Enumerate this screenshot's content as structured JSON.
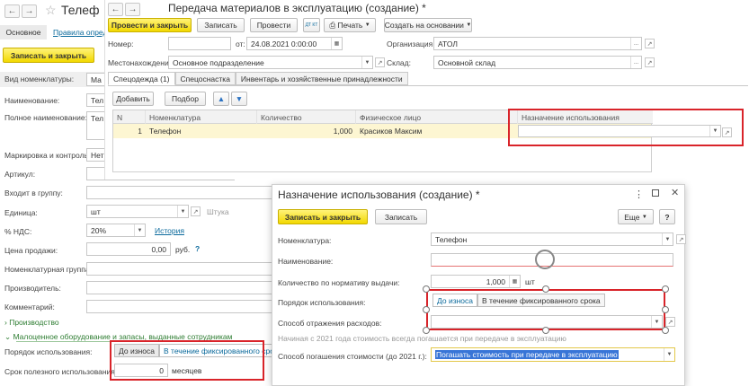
{
  "bg_window": {
    "title": "Телеф",
    "tabs": [
      "Основное",
      "Правила опред"
    ],
    "save_close": "Записать и закрыть",
    "fields": {
      "kind_label": "Вид номенклатуры:",
      "kind_value": "Ма",
      "name_label": "Наименование:",
      "name_value": "Тел",
      "fullname_label": "Полное наименование:",
      "fullname_value": "Тел",
      "marking_label": "Маркировка и контроль:",
      "marking_value": "Нет",
      "article_label": "Артикул:",
      "group_label": "Входит в группу:",
      "unit_label": "Единица:",
      "unit_value": "шт",
      "unit_hint": "Штука",
      "vat_label": "% НДС:",
      "vat_value": "20%",
      "vat_link": "История",
      "price_label": "Цена продажи:",
      "price_value": "0,00",
      "price_unit": "руб.",
      "price_help": "?",
      "nomgroup_label": "Номенклатурная группа:",
      "producer_label": "Производитель:",
      "comment_label": "Комментарий:"
    },
    "section_production": "Производство",
    "section_low": "Малоценное оборудование и запасы, выданные сотрудникам",
    "usage_order_label": "Порядок использования:",
    "usage_options": [
      "До износа",
      "В течение фиксированного срока"
    ],
    "life_label": "Срок полезного использования:",
    "life_value": "0",
    "life_unit": "месяцев"
  },
  "doc_window": {
    "title": "Передача материалов в эксплуатацию (создание) *",
    "toolbar": {
      "post_close": "Провести и закрыть",
      "save": "Записать",
      "post": "Провести",
      "dt_kt": "ДТ КТ",
      "print": "Печать",
      "create_based": "Создать на основании"
    },
    "number_label": "Номер:",
    "date_label": "от:",
    "date_value": "24.08.2021  0:00:00",
    "org_label": "Организация:",
    "org_value": "АТОЛ",
    "location_label": "Местонахождение:",
    "location_value": "Основное подразделение",
    "warehouse_label": "Склад:",
    "warehouse_value": "Основной склад",
    "tabs": [
      "Спецодежда (1)",
      "Спецоснастка",
      "Инвентарь и хозяйственные принадлежности"
    ],
    "add_button": "Добавить",
    "select_button": "Подбор",
    "columns": [
      "N",
      "Номенклатура",
      "Количество",
      "Физическое лицо",
      "Назначение использования"
    ],
    "rows": [
      {
        "n": "1",
        "nom": "Телефон",
        "qty": "1,000",
        "person": "Красиков Максим",
        "purpose": ""
      }
    ]
  },
  "dialog": {
    "title": "Назначение использования (создание) *",
    "save_close": "Записать и закрыть",
    "save": "Записать",
    "more": "Еще",
    "help": "?",
    "nom_label": "Номенклатура:",
    "nom_value": "Телефон",
    "name_label": "Наименование:",
    "qty_label": "Количество по нормативу выдачи:",
    "qty_value": "1,000",
    "qty_unit": "шт",
    "order_label": "Порядок использования:",
    "order_options": [
      "До износа",
      "В течение фиксированного срока"
    ],
    "expense_label": "Способ отражения расходов:",
    "note": "Начиная с 2021 года стоимость всегда погашается при передаче в эксплуатацию",
    "repay_label": "Способ погашения стоимости (до 2021 г.):",
    "repay_value": "Погашать стоимость при передаче в эксплуатацию"
  },
  "colors": {
    "accent_yellow": "#f2d800",
    "highlight_red": "#d9242a",
    "link": "#0b6a9c",
    "selected_row": "#fdf6d2"
  }
}
